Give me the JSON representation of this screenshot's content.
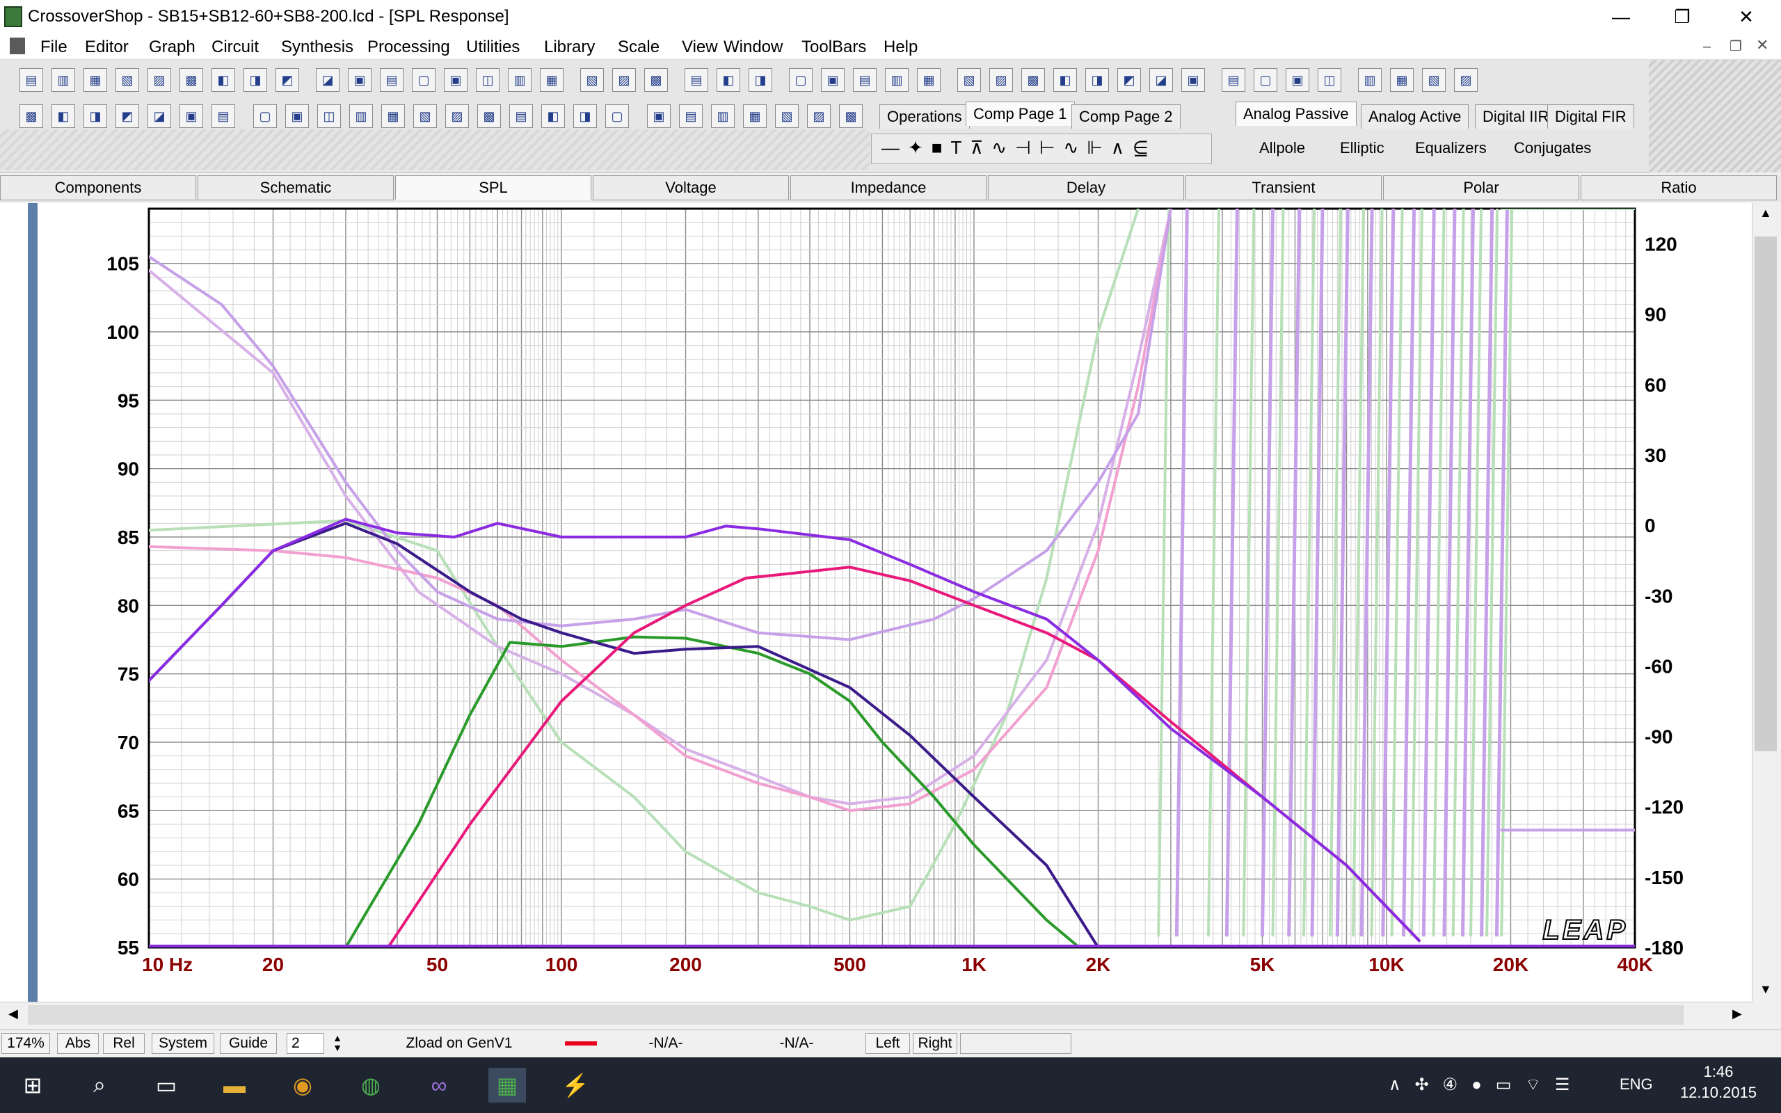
{
  "window": {
    "title": "CrossoverShop - SB15+SB12-60+SB8-200.lcd - [SPL Response]",
    "minimize": "—",
    "restore": "❐",
    "close": "✕"
  },
  "menu": [
    "File",
    "Editor",
    "Graph",
    "Circuit",
    "Synthesis",
    "Processing",
    "Utilities",
    "Library",
    "Scale",
    "View",
    "Window",
    "ToolBars",
    "Help"
  ],
  "toolbar": {
    "row1_count": 44,
    "row2_count": 27,
    "group_tabs": [
      {
        "label": "Operations",
        "active": false
      },
      {
        "label": "Comp Page 1",
        "active": true
      },
      {
        "label": "Comp Page 2",
        "active": false
      }
    ],
    "filter_tabs": [
      {
        "label": "Analog Passive",
        "active": true
      },
      {
        "label": "Analog Active",
        "active": false
      },
      {
        "label": "Digital IIR",
        "active": false
      },
      {
        "label": "Digital FIR",
        "active": false
      }
    ],
    "filter_subs": [
      "Allpole",
      "Elliptic",
      "Equalizers",
      "Conjugates"
    ]
  },
  "view_tabs": [
    {
      "label": "Components",
      "active": false
    },
    {
      "label": "Schematic",
      "active": false
    },
    {
      "label": "SPL",
      "active": true
    },
    {
      "label": "Voltage",
      "active": false
    },
    {
      "label": "Impedance",
      "active": false
    },
    {
      "label": "Delay",
      "active": false
    },
    {
      "label": "Transient",
      "active": false
    },
    {
      "label": "Polar",
      "active": false
    },
    {
      "label": "Ratio",
      "active": false
    }
  ],
  "chart_data": {
    "type": "line",
    "xscale": "log",
    "xlim": [
      10,
      40000
    ],
    "ylim": [
      55,
      109
    ],
    "ylim_right": [
      -180,
      135
    ],
    "x_ticks": [
      {
        "v": 10,
        "label": "10  Hz"
      },
      {
        "v": 20,
        "label": "20"
      },
      {
        "v": 50,
        "label": "50"
      },
      {
        "v": 100,
        "label": "100"
      },
      {
        "v": 200,
        "label": "200"
      },
      {
        "v": 500,
        "label": "500"
      },
      {
        "v": 1000,
        "label": "1K"
      },
      {
        "v": 2000,
        "label": "2K"
      },
      {
        "v": 5000,
        "label": "5K"
      },
      {
        "v": 10000,
        "label": "10K"
      },
      {
        "v": 20000,
        "label": "20K"
      },
      {
        "v": 40000,
        "label": "40K"
      }
    ],
    "y_ticks": [
      105,
      100,
      95,
      90,
      85,
      80,
      75,
      70,
      65,
      60,
      55
    ],
    "y_ticks_right": [
      120,
      90,
      60,
      30,
      0,
      -30,
      -60,
      -90,
      -120,
      -150,
      -180
    ],
    "logo": "LEAP",
    "grid": true,
    "series": [
      {
        "color": "#8a2be2",
        "width": 4,
        "points": [
          [
            10,
            74.5
          ],
          [
            15,
            80
          ],
          [
            20,
            84
          ],
          [
            30,
            86.3
          ],
          [
            40,
            85.3
          ],
          [
            55,
            85
          ],
          [
            70,
            86
          ],
          [
            100,
            85
          ],
          [
            150,
            85
          ],
          [
            200,
            85
          ],
          [
            250,
            85.8
          ],
          [
            300,
            85.6
          ],
          [
            500,
            84.8
          ],
          [
            700,
            83
          ],
          [
            1000,
            81
          ],
          [
            1500,
            79
          ],
          [
            2000,
            76
          ],
          [
            3000,
            71
          ],
          [
            5000,
            66
          ],
          [
            8000,
            61
          ],
          [
            12000,
            55.5
          ]
        ]
      },
      {
        "color": "#e8197a",
        "width": 4,
        "points": [
          [
            10,
            55
          ],
          [
            38,
            55
          ],
          [
            60,
            64
          ],
          [
            100,
            73
          ],
          [
            150,
            78
          ],
          [
            200,
            80
          ],
          [
            280,
            82
          ],
          [
            350,
            82.3
          ],
          [
            500,
            82.8
          ],
          [
            700,
            81.8
          ],
          [
            1000,
            80
          ],
          [
            1500,
            78
          ],
          [
            2000,
            76
          ],
          [
            3000,
            71.5
          ],
          [
            5000,
            66
          ],
          [
            8000,
            61
          ],
          [
            12000,
            55.5
          ]
        ]
      },
      {
        "color": "#3b1b8a",
        "width": 4,
        "points": [
          [
            10,
            74.5
          ],
          [
            15,
            80
          ],
          [
            20,
            84
          ],
          [
            30,
            86
          ],
          [
            40,
            84.5
          ],
          [
            60,
            81
          ],
          [
            80,
            79
          ],
          [
            100,
            78
          ],
          [
            150,
            76.5
          ],
          [
            200,
            76.8
          ],
          [
            300,
            77
          ],
          [
            500,
            74
          ],
          [
            700,
            70.5
          ],
          [
            1000,
            66
          ],
          [
            1500,
            61
          ],
          [
            2000,
            55
          ]
        ]
      },
      {
        "color": "#2a9a2a",
        "width": 4,
        "points": [
          [
            30,
            55
          ],
          [
            45,
            64
          ],
          [
            60,
            72
          ],
          [
            75,
            77.3
          ],
          [
            100,
            77
          ],
          [
            150,
            77.7
          ],
          [
            200,
            77.6
          ],
          [
            300,
            76.5
          ],
          [
            400,
            75
          ],
          [
            500,
            73
          ],
          [
            600,
            70
          ],
          [
            800,
            66
          ],
          [
            1000,
            62.5
          ],
          [
            1500,
            57
          ],
          [
            1800,
            55
          ]
        ]
      },
      {
        "color": "#c6a0e8",
        "width": 4,
        "points": [
          [
            10,
            105.5
          ],
          [
            15,
            102
          ],
          [
            20,
            97.5
          ],
          [
            30,
            89
          ],
          [
            40,
            84
          ],
          [
            50,
            81
          ],
          [
            70,
            79
          ],
          [
            100,
            78.5
          ],
          [
            150,
            79
          ],
          [
            200,
            79.7
          ],
          [
            300,
            78
          ],
          [
            500,
            77.5
          ],
          [
            800,
            79
          ],
          [
            1000,
            80.5
          ],
          [
            1500,
            84
          ],
          [
            2000,
            89
          ],
          [
            2500,
            94
          ],
          [
            3000,
            109
          ]
        ]
      },
      {
        "color": "#f2a0d0",
        "width": 4,
        "points": [
          [
            10,
            84.3
          ],
          [
            20,
            84
          ],
          [
            30,
            83.5
          ],
          [
            50,
            82
          ],
          [
            70,
            80
          ],
          [
            100,
            76
          ],
          [
            150,
            72
          ],
          [
            200,
            69
          ],
          [
            300,
            67
          ],
          [
            400,
            66
          ],
          [
            500,
            65
          ],
          [
            700,
            65.5
          ],
          [
            1000,
            68
          ],
          [
            1500,
            74
          ],
          [
            2000,
            84
          ],
          [
            2500,
            96
          ],
          [
            3000,
            109
          ]
        ]
      },
      {
        "color": "#b8e0b8",
        "width": 4,
        "points": [
          [
            10,
            85.5
          ],
          [
            30,
            86.2
          ],
          [
            50,
            84
          ],
          [
            70,
            77
          ],
          [
            100,
            70
          ],
          [
            150,
            66
          ],
          [
            200,
            62
          ],
          [
            300,
            59
          ],
          [
            400,
            58
          ],
          [
            500,
            57
          ],
          [
            700,
            58
          ],
          [
            900,
            64
          ],
          [
            1200,
            72
          ],
          [
            1500,
            82
          ],
          [
            2000,
            100
          ],
          [
            2500,
            109
          ]
        ]
      },
      {
        "color": "#d8b0e8",
        "width": 4,
        "points": [
          [
            10,
            104.5
          ],
          [
            20,
            97
          ],
          [
            30,
            88
          ],
          [
            45,
            81
          ],
          [
            70,
            77
          ],
          [
            100,
            75
          ],
          [
            150,
            72
          ],
          [
            200,
            69.5
          ],
          [
            300,
            67.5
          ],
          [
            400,
            66
          ],
          [
            500,
            65.5
          ],
          [
            700,
            66
          ],
          [
            1000,
            69
          ],
          [
            1500,
            76
          ],
          [
            2000,
            86
          ],
          [
            2500,
            98
          ],
          [
            3000,
            109
          ]
        ]
      }
    ],
    "right_series": [
      {
        "color": "#b8e0b8",
        "width": 4,
        "points": [
          [
            19000,
            135
          ],
          [
            40000,
            135
          ]
        ]
      },
      {
        "color": "#c6a0e8",
        "width": 4,
        "points": [
          [
            19000,
            -130
          ],
          [
            40000,
            -130
          ]
        ]
      }
    ],
    "wrap_lines": [
      {
        "color": "#b8e0b8",
        "x": [
          2800,
          3700,
          4500,
          5300,
          6300,
          7300,
          8300,
          9200,
          10300,
          11500,
          13000,
          14500,
          16000,
          17500,
          19000
        ],
        "w": 4
      },
      {
        "color": "#c6a0e8",
        "x": [
          3100,
          4100,
          5000,
          5800,
          6600,
          7600,
          8700,
          9800,
          11000,
          12300,
          13800,
          15300,
          17000,
          18500
        ],
        "w": 5
      }
    ]
  },
  "status": {
    "zoom": "174%",
    "abs": "Abs",
    "rel": "Rel",
    "system": "System",
    "guide": "Guide",
    "guide_value": "2",
    "zload": "Zload on GenV1",
    "na1": "-N/A-",
    "na2": "-N/A-",
    "left": "Left",
    "right": "Right"
  },
  "taskbar": {
    "lang": "ENG",
    "time": "1:46",
    "date": "12.10.2015"
  }
}
